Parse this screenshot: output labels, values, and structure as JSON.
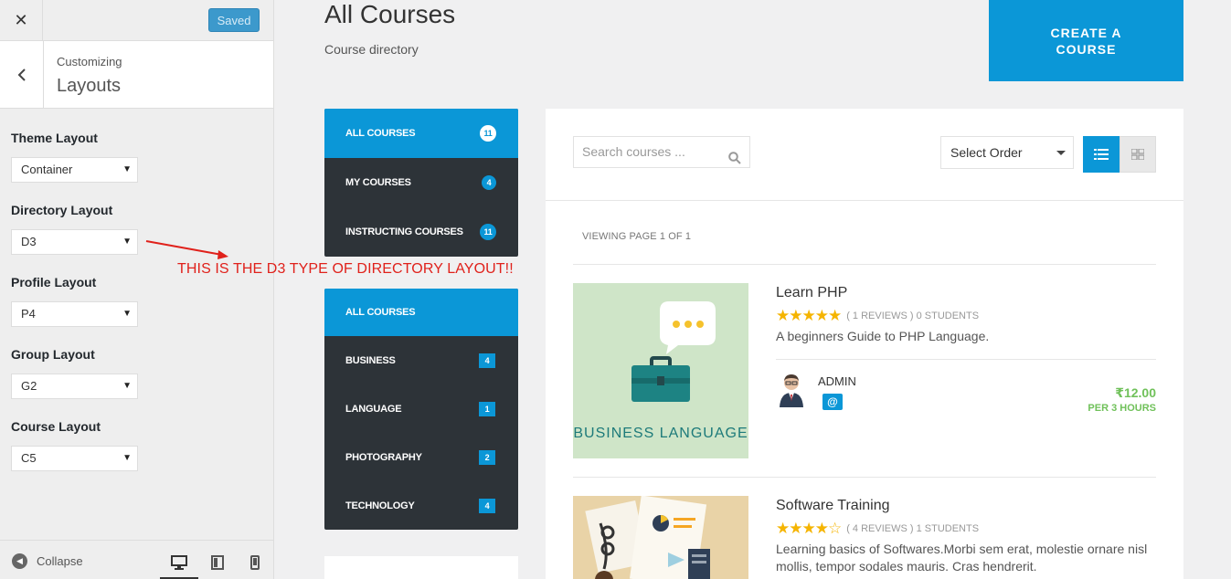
{
  "customizer": {
    "saved_label": "Saved",
    "subtitle": "Customizing",
    "title": "Layouts",
    "fields": [
      {
        "label": "Theme Layout",
        "value": "Container"
      },
      {
        "label": "Directory Layout",
        "value": "D3"
      },
      {
        "label": "Profile Layout",
        "value": "P4"
      },
      {
        "label": "Group Layout",
        "value": "G2"
      },
      {
        "label": "Course Layout",
        "value": "C5"
      }
    ],
    "collapse_label": "Collapse"
  },
  "annotation": "THIS IS THE D3 TYPE OF DIRECTORY LAYOUT!!",
  "page": {
    "title": "All Courses",
    "subtitle": "Course directory",
    "create_button": "CREATE A COURSE"
  },
  "menu1": [
    {
      "label": "ALL COURSES",
      "count": "11"
    },
    {
      "label": "MY COURSES",
      "count": "4"
    },
    {
      "label": "INSTRUCTING COURSES",
      "count": "11"
    }
  ],
  "menu2": [
    {
      "label": "ALL COURSES",
      "count": ""
    },
    {
      "label": "BUSINESS",
      "count": "4"
    },
    {
      "label": "LANGUAGE",
      "count": "1"
    },
    {
      "label": "PHOTOGRAPHY",
      "count": "2"
    },
    {
      "label": "TECHNOLOGY",
      "count": "4"
    }
  ],
  "panel": {
    "search_placeholder": "Search courses ...",
    "order_label": "Select Order",
    "viewing": "VIEWING PAGE 1 OF 1"
  },
  "courses": [
    {
      "title": "Learn PHP",
      "rating": 5,
      "meta": "( 1 REVIEWS )  0 STUDENTS",
      "description": "A beginners Guide to PHP Language.",
      "thumb_text": "BUSINESS LANGUAGE",
      "instructor": "ADMIN",
      "price": "₹12.00",
      "price_per": "PER 3 HOURS"
    },
    {
      "title": "Software Training",
      "rating": 4,
      "meta": "( 4 REVIEWS )  1 STUDENTS",
      "description": "Learning basics of Softwares.Morbi sem erat, molestie ornare nisl mollis, tempor sodales mauris. Cras hendrerit."
    }
  ],
  "colors": {
    "accent": "#0b97d7",
    "menu_bg": "#2d3338",
    "price": "#70c15a",
    "annotation": "#e0211b",
    "star": "#f5b400"
  }
}
